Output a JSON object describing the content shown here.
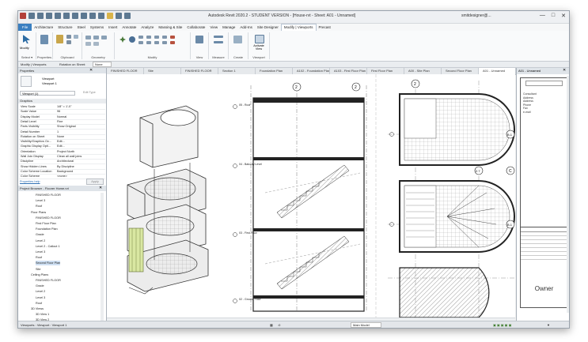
{
  "app": {
    "title": "Autodesk Revit 2020.2 - STUDENT VERSION - [House-rvt - Sheet: A01 - Unnamed]",
    "user": "smitdesigner@...",
    "window_controls": [
      "—",
      "□",
      "✕"
    ]
  },
  "ribbon_tabs": [
    "File",
    "Architecture",
    "Structure",
    "Steel",
    "Systems",
    "Insert",
    "Annotate",
    "Analyze",
    "Massing & Site",
    "Collaborate",
    "View",
    "Manage",
    "Add-Ins",
    "Site Designer",
    "Modify | Viewports",
    "Precast"
  ],
  "ribbon_active_tab": "Modify | Viewports",
  "ribbon_groups": [
    {
      "label": "Select ▾"
    },
    {
      "label": "Properties"
    },
    {
      "label": "Clipboard"
    },
    {
      "label": "Geometry"
    },
    {
      "label": "Modify"
    },
    {
      "label": "View"
    },
    {
      "label": "Measure"
    },
    {
      "label": "Create"
    },
    {
      "label": "Viewport"
    }
  ],
  "ribbon_buttons": {
    "modify": "Modify",
    "activate_view": "Activate View"
  },
  "options_bar": {
    "context": "Modify | Viewports",
    "rotation_label": "Rotation on Sheet:",
    "rotation_value": "None"
  },
  "properties_panel": {
    "title": "Properties",
    "type_name": "Viewport",
    "type_sub": "Viewport 1",
    "selector": "Viewport (1)",
    "edit_type": "Edit Type",
    "section": "Graphics",
    "rows": [
      {
        "k": "View Scale",
        "v": "1/8\" = 1'-0\""
      },
      {
        "k": "Scale Value",
        "v": "96"
      },
      {
        "k": "Display Model",
        "v": "Normal"
      },
      {
        "k": "Detail Level",
        "v": "Fine"
      },
      {
        "k": "Parts Visibility",
        "v": "Show Original"
      },
      {
        "k": "Detail Number",
        "v": "1"
      },
      {
        "k": "Rotation on Sheet",
        "v": "None"
      },
      {
        "k": "Visibility/Graphics Ov...",
        "v": "Edit..."
      },
      {
        "k": "Graphic Display Opti...",
        "v": "Edit..."
      },
      {
        "k": "Orientation",
        "v": "Project North"
      },
      {
        "k": "Wall Join Display",
        "v": "Clean all wall joins"
      },
      {
        "k": "Discipline",
        "v": "Architectural"
      },
      {
        "k": "Show Hidden Lines",
        "v": "By Discipline"
      },
      {
        "k": "Color Scheme Location",
        "v": "Background"
      },
      {
        "k": "Color Scheme",
        "v": "<none>"
      }
    ],
    "help_link": "Properties help",
    "apply": "Apply"
  },
  "project_browser": {
    "title": "Project Browser - Floorer Home.rvt",
    "items": [
      {
        "label": "FINISHED FLOOR",
        "indent": 3
      },
      {
        "label": "Level 3",
        "indent": 3
      },
      {
        "label": "Roof",
        "indent": 3
      },
      {
        "label": "Floor Plans",
        "indent": 2
      },
      {
        "label": "FINISHED FLOOR",
        "indent": 3
      },
      {
        "label": "First Floor Plan",
        "indent": 3
      },
      {
        "label": "Foundation Plan",
        "indent": 3
      },
      {
        "label": "Grade",
        "indent": 3
      },
      {
        "label": "Level 2",
        "indent": 3
      },
      {
        "label": "Level 2 - Callout 1",
        "indent": 3
      },
      {
        "label": "Level 3",
        "indent": 3
      },
      {
        "label": "Roof",
        "indent": 3
      },
      {
        "label": "Second Floor Plan",
        "indent": 3
      },
      {
        "label": "Site",
        "indent": 3
      },
      {
        "label": "Ceiling Plans",
        "indent": 2
      },
      {
        "label": "FINISHED FLOOR",
        "indent": 3
      },
      {
        "label": "Grade",
        "indent": 3
      },
      {
        "label": "Level 2",
        "indent": 3
      },
      {
        "label": "Level 3",
        "indent": 3
      },
      {
        "label": "Roof",
        "indent": 3
      },
      {
        "label": "3D Views",
        "indent": 2
      },
      {
        "label": "3D View 1",
        "indent": 3
      },
      {
        "label": "3D View 2",
        "indent": 3
      }
    ],
    "selected_index": 12
  },
  "view_tabs": [
    "FINISHED FLOOR",
    "Site",
    "FINISHED FLOOR",
    "Section 1",
    "Foundation Plan",
    "A102 - Foundation Plan",
    "A103 - First Floor Plan",
    "First Floor Plan",
    "A00 - Site Plan",
    "Second Floor Plan",
    "A01 - Unnamed"
  ],
  "drawing": {
    "grid_bubbles": [
      "2",
      "2",
      "2",
      "2.7",
      "B.1",
      "C",
      "B.1"
    ],
    "level_tags": [
      "05 - Roof",
      "04 - Balcony Level",
      "03 - First Floor",
      "02 - Ground Floor"
    ]
  },
  "sheet_panel": {
    "title": "A01 - Unnamed",
    "owner": "Owner",
    "notes": [
      "Consultant",
      "Address",
      "Address",
      "Phone",
      "Fax",
      "e-mail"
    ]
  },
  "status_bar": {
    "left": "Viewports : Viewport : Viewport 1",
    "model": "Main Model",
    "zero": ":0"
  }
}
